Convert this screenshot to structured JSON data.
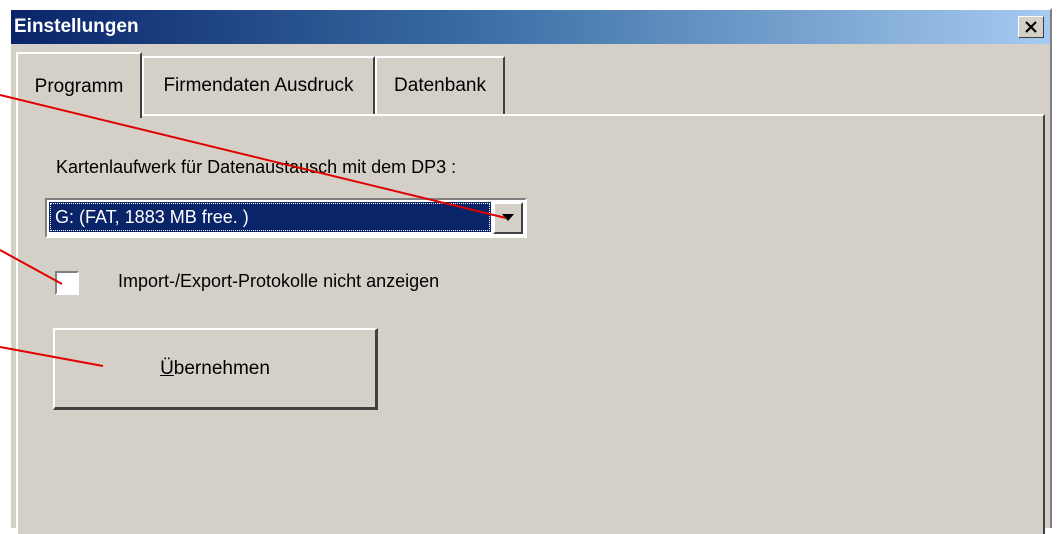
{
  "window": {
    "title": "Einstellungen",
    "close_glyph": "×"
  },
  "tabs": [
    {
      "label": "Programm",
      "active": true
    },
    {
      "label": "Firmendaten Ausdruck",
      "active": false
    },
    {
      "label": "Datenbank",
      "active": false
    }
  ],
  "programm": {
    "drive_label": "Kartenlaufwerk für Datenaustausch mit dem DP3 :",
    "drive_selected": "G:  (FAT, 1883 MB free. )",
    "hide_protocols_label": "Import-/Export-Protokolle nicht anzeigen",
    "hide_protocols_checked": false,
    "apply_button_mnemonic": "Ü",
    "apply_button_rest": "bernehmen"
  },
  "colors": {
    "annotation_arrow": "#e00000",
    "selection_bg": "#0a246a",
    "dialog_bg": "#d4d0c8"
  },
  "icons": {
    "close": "close-icon",
    "dropdown": "chevron-down-icon"
  }
}
